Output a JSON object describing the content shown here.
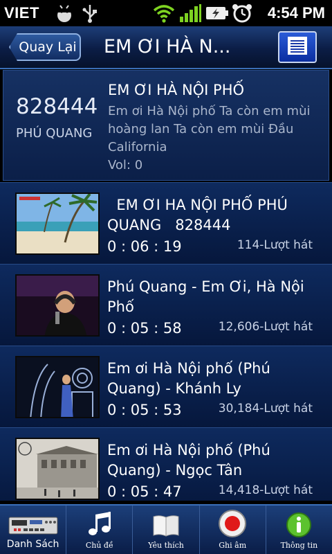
{
  "status_bar": {
    "carrier": "VIET",
    "time": "4:54 PM",
    "icons": [
      "android-bug-icon",
      "usb-icon",
      "wifi-icon",
      "signal-icon",
      "battery-charging-icon",
      "alarm-icon"
    ]
  },
  "header": {
    "back_label": "Quay Lại",
    "title": "EM ƠI HÀ N...",
    "menu_icon": "list-icon"
  },
  "current_song": {
    "code": "828444",
    "artist": "PHÚ QUANG",
    "title": "EM ƠI HÀ NỘI PHỐ",
    "lyrics": "Em ơi Hà Nội phố Ta còn em mùi hoàng lan Ta còn em mùi Đầu California",
    "volume": "Vol: 0"
  },
  "songs": [
    {
      "title": "  EM ƠI HA NỘI PHỐ PHÚ QUANG   828444",
      "duration": "0 : 06 : 19",
      "count": "114-Lượt hát",
      "thumb": "beach"
    },
    {
      "title": "Phú Quang - Em Ơi, Hà Nội Phố",
      "duration": "0 : 05 : 58",
      "count": "12,606-Lượt hát",
      "thumb": "singer"
    },
    {
      "title": "Em ơi Hà Nội phố (Phú Quang) - Khánh Ly",
      "duration": "0 : 05 : 53",
      "count": "30,184-Lượt hát",
      "thumb": "stage"
    },
    {
      "title": "Em ơi Hà Nội phố (Phú Quang) - Ngọc Tân",
      "duration": "0 : 05 : 47",
      "count": "14,418-Lượt hát",
      "thumb": "oldphoto"
    }
  ],
  "tabs": [
    {
      "label": "Danh Sách",
      "icon": "karaoke-player-icon"
    },
    {
      "label": "Chủ đề",
      "icon": "music-note-icon"
    },
    {
      "label": "Yêu thích",
      "icon": "book-icon"
    },
    {
      "label": "Ghi âm",
      "icon": "record-icon"
    },
    {
      "label": "Thông tin",
      "icon": "info-icon"
    }
  ],
  "colors": {
    "background": "#061638",
    "header": "#1d3e78",
    "accent": "#3a6fb8",
    "record_red": "#e01a1a",
    "info_green": "#5cc22e"
  }
}
